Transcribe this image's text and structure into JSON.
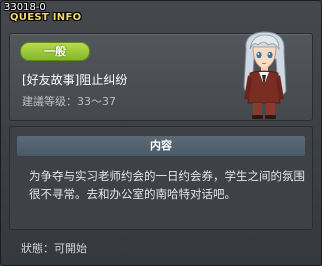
{
  "window": {
    "quest_id": "33018-0",
    "title": "QUEST INFO"
  },
  "quest": {
    "category_badge": "一般",
    "name": "[好友故事]阻止纠纷",
    "level_range": "建議等级：33～37"
  },
  "content": {
    "header": "内容",
    "description": "为争夺与实习老师约会的一日约会券，学生之间的氛围很不寻常。去和办公室的南哈特对话吧。"
  },
  "status": {
    "text": "狀態：可開始"
  },
  "colors": {
    "badge_green": "#9ccc3a",
    "title_yellow": "#f2d86a",
    "header_blue": "#54626f"
  },
  "icons": {
    "npc_portrait": "npc-portrait-icon"
  }
}
